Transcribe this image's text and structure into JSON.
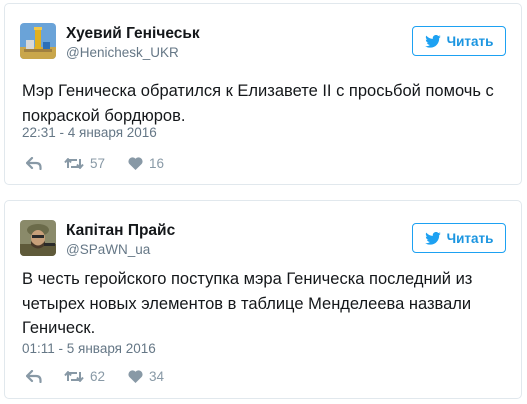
{
  "tweets": [
    {
      "author_name": "Хуевий Генічеськ",
      "author_handle": "@Henichesk_UKR",
      "follow_label": "Читать",
      "text": "Мэр Геническа  обратился к Елизавете II с просьбой помочь с покраской бордюров.",
      "timestamp": "22:31 - 4 января 2016",
      "retweets": "57",
      "likes": "16",
      "avatar_icon": "monument-avatar"
    },
    {
      "author_name": "Капітан Прайс",
      "author_handle": "@SPaWN_ua",
      "follow_label": "Читать",
      "text": "В честь геройского поступка мэра Геническа последний из четырех новых элементов в таблице Менделеева назвали Геническ.",
      "timestamp": "01:11 - 5 января 2016",
      "retweets": "62",
      "likes": "34",
      "avatar_icon": "soldier-avatar"
    }
  ],
  "icons": {
    "follow": "twitter-bird-icon",
    "reply": "reply-icon",
    "retweet": "retweet-icon",
    "like": "heart-icon"
  },
  "colors": {
    "accent": "#1da1f2",
    "text": "#14171a",
    "muted": "#657786",
    "action": "#8899a6",
    "border": "#e1e8ed"
  }
}
